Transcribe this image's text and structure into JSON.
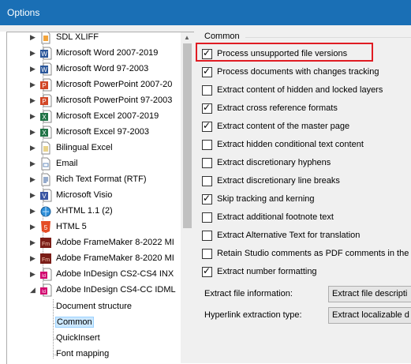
{
  "window": {
    "title": "Options"
  },
  "tree": {
    "file_types": [
      {
        "label": "SDL XLIFF",
        "icon": "xliff-file-icon"
      },
      {
        "label": "Microsoft Word 2007-2019",
        "icon": "word-file-icon"
      },
      {
        "label": "Microsoft Word 97-2003",
        "icon": "word-file-icon"
      },
      {
        "label": "Microsoft PowerPoint 2007-20",
        "icon": "powerpoint-file-icon"
      },
      {
        "label": "Microsoft PowerPoint 97-2003",
        "icon": "powerpoint-file-icon"
      },
      {
        "label": "Microsoft Excel 2007-2019",
        "icon": "excel-file-icon"
      },
      {
        "label": "Microsoft Excel 97-2003",
        "icon": "excel-file-icon"
      },
      {
        "label": "Bilingual Excel",
        "icon": "bilingual-excel-file-icon"
      },
      {
        "label": "Email",
        "icon": "email-file-icon"
      },
      {
        "label": "Rich Text Format (RTF)",
        "icon": "rtf-file-icon"
      },
      {
        "label": "Microsoft Visio",
        "icon": "visio-file-icon"
      },
      {
        "label": "XHTML 1.1 (2)",
        "icon": "xhtml-file-icon"
      },
      {
        "label": "HTML 5",
        "icon": "html5-file-icon"
      },
      {
        "label": "Adobe FrameMaker 8-2022 MI",
        "icon": "framemaker-file-icon"
      },
      {
        "label": "Adobe FrameMaker 8-2020 MI",
        "icon": "framemaker-file-icon"
      },
      {
        "label": "Adobe InDesign CS2-CS4 INX",
        "icon": "indesign-file-icon"
      },
      {
        "label": "Adobe InDesign CS4-CC IDML",
        "icon": "indesign-file-icon"
      }
    ],
    "children": [
      {
        "label": "Document structure",
        "selected": false
      },
      {
        "label": "Common",
        "selected": true
      },
      {
        "label": "QuickInsert",
        "selected": false
      },
      {
        "label": "Font mapping",
        "selected": false
      }
    ]
  },
  "common": {
    "group_title": "Common",
    "options": [
      {
        "label": "Process unsupported file versions",
        "checked": true
      },
      {
        "label": "Process documents with changes tracking",
        "checked": true
      },
      {
        "label": "Extract content of hidden and locked layers",
        "checked": false
      },
      {
        "label": "Extract cross reference formats",
        "checked": true
      },
      {
        "label": "Extract content of the master page",
        "checked": true
      },
      {
        "label": "Extract hidden conditional text content",
        "checked": false
      },
      {
        "label": "Extract discretionary hyphens",
        "checked": false
      },
      {
        "label": "Extract discretionary line breaks",
        "checked": false
      },
      {
        "label": "Skip tracking and kerning",
        "checked": true
      },
      {
        "label": "Extract additional footnote text",
        "checked": false
      },
      {
        "label": "Extract Alternative Text for translation",
        "checked": false
      },
      {
        "label": "Retain Studio comments as PDF comments in the",
        "checked": false
      },
      {
        "label": "Extract number formatting",
        "checked": true
      }
    ],
    "file_info_label": "Extract file information:",
    "file_info_value": "Extract file descripti",
    "hyperlink_label": "Hyperlink extraction type:",
    "hyperlink_value": "Extract localizable d"
  },
  "colors": {
    "titlebar": "#1a6fb5",
    "highlight": "#e01c23",
    "selection": "#cce8ff"
  }
}
